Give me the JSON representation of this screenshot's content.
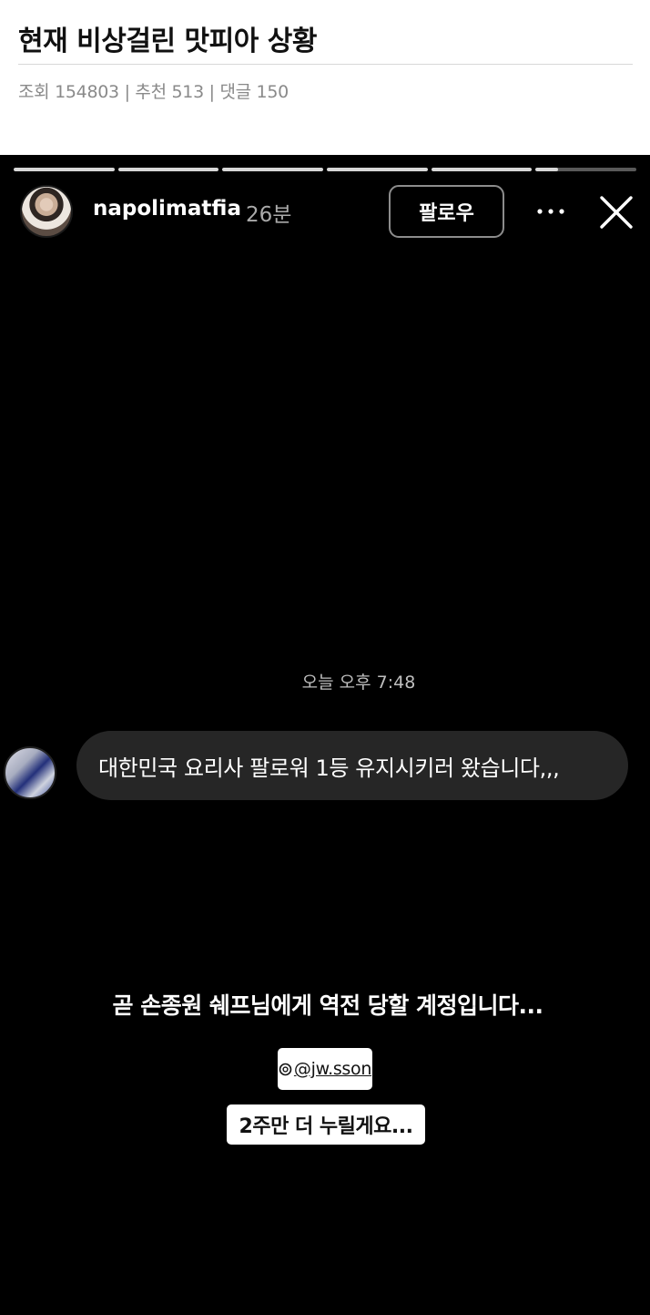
{
  "post": {
    "title": "현재 비상걸린 맛피아 상황",
    "stats": "조회 154803 | 추천 513 | 댓글 150"
  },
  "story": {
    "progress": [
      1,
      1,
      1,
      1,
      1,
      0.22
    ],
    "username": "napolimatfia",
    "time_ago": "26분",
    "follow_label": "팔로우",
    "more_icon": "more-horizontal-icon",
    "close_icon": "close-icon",
    "dm_timestamp": "오늘 오후 7:48",
    "dm_message": "대한민국 요리사 팔로워 1등 유지시키러 왔습니다,,,",
    "caption_main": "곧 손종원 쉐프님에게 역전 당할 계정입니다...",
    "mention": "@jw.sson",
    "caption_sub": "2주만 더 누릴게요..."
  },
  "colors": {
    "story_bg": "#000000",
    "bubble_bg": "#262626",
    "follow_border": "#8c8c8c"
  }
}
